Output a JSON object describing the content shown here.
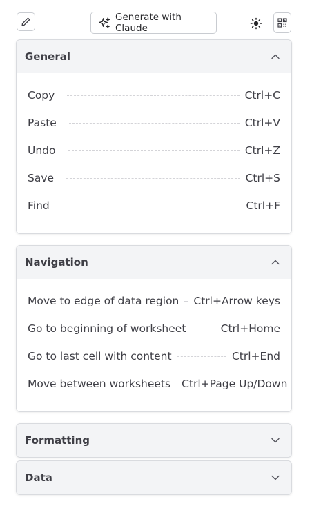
{
  "toolbar": {
    "generate_label": "Generate with Claude"
  },
  "sections": [
    {
      "title": "General",
      "expanded": true,
      "shortcuts": [
        {
          "action": "Copy",
          "keys": "Ctrl+C"
        },
        {
          "action": "Paste",
          "keys": "Ctrl+V"
        },
        {
          "action": "Undo",
          "keys": "Ctrl+Z"
        },
        {
          "action": "Save",
          "keys": "Ctrl+S"
        },
        {
          "action": "Find",
          "keys": "Ctrl+F"
        }
      ]
    },
    {
      "title": "Navigation",
      "expanded": true,
      "shortcuts": [
        {
          "action": "Move to edge of data region",
          "keys": "Ctrl+Arrow keys"
        },
        {
          "action": "Go to beginning of worksheet",
          "keys": "Ctrl+Home"
        },
        {
          "action": "Go to last cell with content",
          "keys": "Ctrl+End"
        },
        {
          "action": "Move between worksheets",
          "keys": "Ctrl+Page Up/Down"
        }
      ]
    },
    {
      "title": "Formatting",
      "expanded": false
    },
    {
      "title": "Data",
      "expanded": false
    }
  ]
}
